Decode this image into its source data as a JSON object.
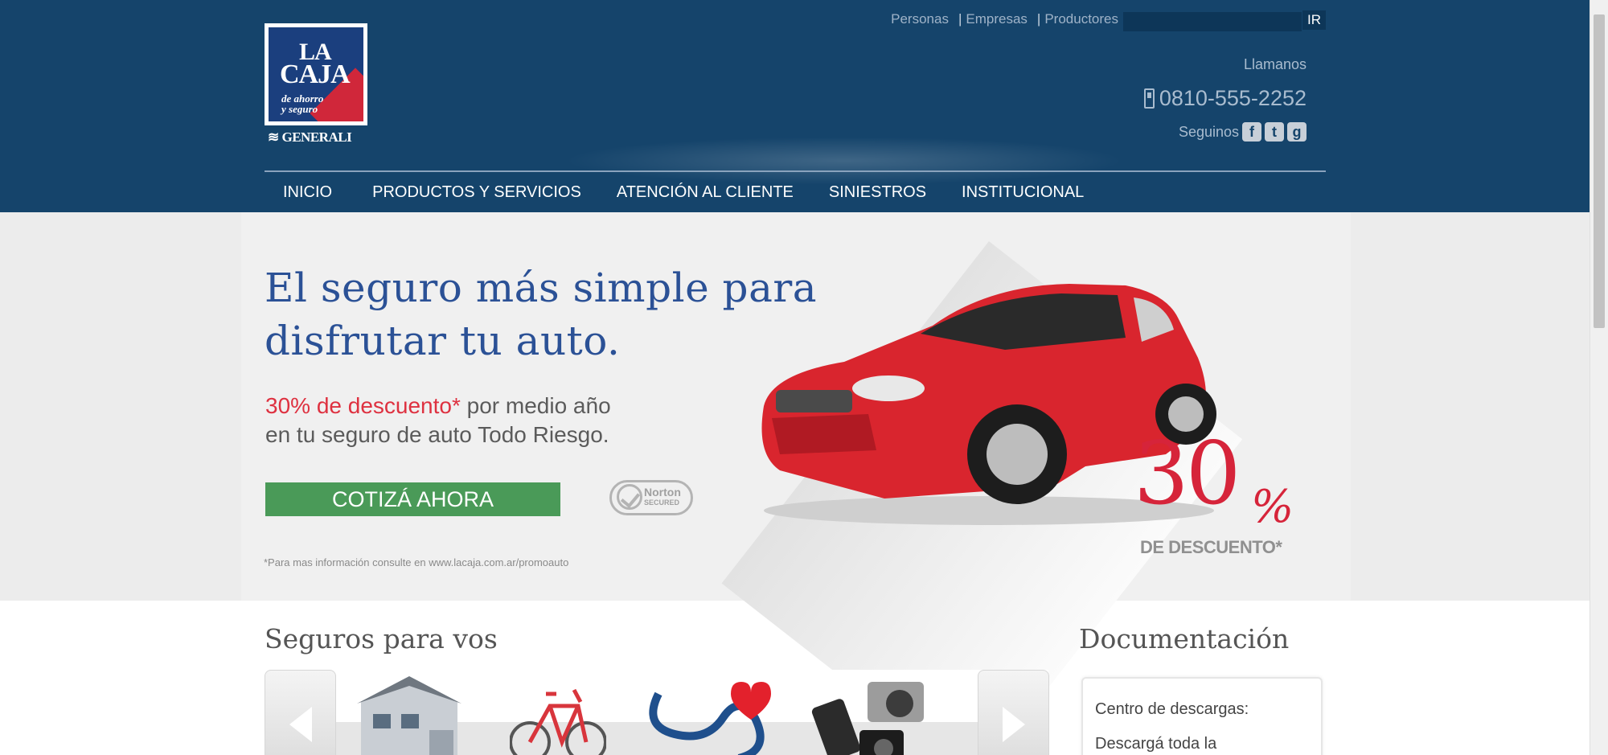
{
  "brand": {
    "logo_la": "LA",
    "logo_caja": "CAJA",
    "logo_sub_1": "de ahorro",
    "logo_sub_2": "y seguro",
    "logo_generali": "GENERALI",
    "colors": {
      "header": "#15446b",
      "accent_red": "#d6243a",
      "cta_green": "#4a9a58",
      "headline_blue": "#2b5196"
    }
  },
  "toplinks": [
    "Personas",
    "Empresas",
    "Productores"
  ],
  "search": {
    "value": "",
    "button_label": "IR"
  },
  "contact": {
    "llamanos": "Llamanos",
    "phone": "0810-555-2252",
    "seguinos": "Seguinos",
    "social_icons": [
      "facebook-icon",
      "twitter-icon",
      "google-plus-icon"
    ]
  },
  "nav": [
    "INICIO",
    "PRODUCTOS Y SERVICIOS",
    "ATENCIÓN AL CLIENTE",
    "SINIESTROS",
    "INSTITUCIONAL"
  ],
  "banner": {
    "headline_1": "El seguro más simple para",
    "headline_2": "disfrutar tu auto.",
    "discount_highlight": "30% de descuento*",
    "sub_1_rest": " por medio año",
    "sub_2": "en tu seguro de auto Todo Riesgo.",
    "cta_label": "COTIZÁ AHORA",
    "norton_1": "Norton",
    "norton_2": "SECURED",
    "footnote": "*Para mas información consulte en www.lacaja.com.ar/promoauto",
    "pct_number": "30",
    "pct_sign": "%",
    "pct_label": "DE DESCUENTO*"
  },
  "seguros": {
    "title": "Seguros para vos",
    "products": [
      "house-icon",
      "bicycle-icon",
      "stethoscope-heart-icon",
      "electronics-icon"
    ]
  },
  "documentacion": {
    "title": "Documentación",
    "line_1": "Centro de descargas:",
    "line_2": "Descargá toda la"
  }
}
